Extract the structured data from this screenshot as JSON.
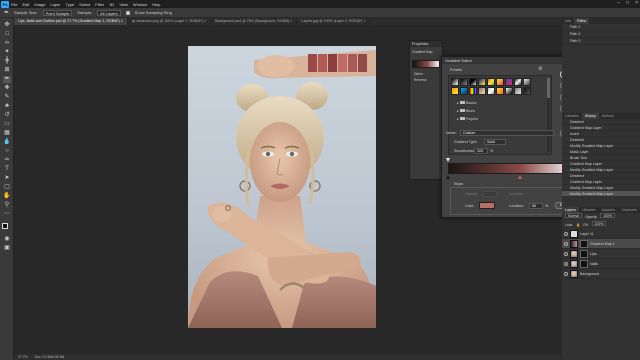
{
  "app": {
    "menu": [
      "File",
      "Edit",
      "Image",
      "Layer",
      "Type",
      "Select",
      "Filter",
      "3D",
      "View",
      "Window",
      "Help"
    ]
  },
  "options_bar": {
    "sample_size_label": "Sample Size:",
    "sample_size_value": "Point Sample",
    "sample_label": "Sample:",
    "sample_value": "All Layers",
    "show_ring": "Show Sampling Ring"
  },
  "tabs": [
    {
      "label": "Lips, Nails and Clothes.psd @ 27.7% (Gradient Map 1, RGB/8*) ×",
      "active": true
    },
    {
      "label": "lip-swatches.png @ 100% (Layer 1, RGB/8*) ×",
      "active": false
    },
    {
      "label": "Background.psd @ 25% (Background, RGB/8) ×",
      "active": false
    },
    {
      "label": "Layers.jpg @ 100% (Layer 0, RGB/8*) ×",
      "active": false
    }
  ],
  "status": {
    "zoom": "27.7%",
    "doc": "Doc: 21.9M/139.3M"
  },
  "properties": {
    "title": "Properties",
    "item": "Gradient Map",
    "dither": "Dither",
    "reverse": "Reverse"
  },
  "gradient_editor": {
    "title": "Gradient Editor",
    "presets_label": "Presets",
    "folders": [
      "Basics",
      "Blues",
      "Purples"
    ],
    "name_label": "Name:",
    "name_value": "Custom",
    "new_button": "New",
    "type_label": "Gradient Type:",
    "type_value": "Solid",
    "smooth_label": "Smoothness:",
    "smooth_value": "100",
    "pct": "%",
    "stops_label": "Stops",
    "opacity_label": "Opacity:",
    "location_label": "Location:",
    "color_label": "Color:",
    "location_value": "56",
    "delete_button": "Delete",
    "ok_button": "OK",
    "cancel_button": "Cancel",
    "import_button": "Import...",
    "export_button": "Export...",
    "stop_color": "#b86d68",
    "gradient_start": "#1b1513",
    "gradient_mid": "#8a4a47",
    "gradient_end": "#ffffff"
  },
  "panels": {
    "info_tabs": [
      "Info",
      "Paths"
    ],
    "paths": [
      "Path 1",
      "Path 2",
      "Path 3"
    ],
    "history_tabs": [
      "Libraries",
      "History",
      "Actions"
    ],
    "history_items": [
      "Deselect",
      "Gradient Map Layer",
      "Invert",
      "Deselect",
      "Modify Gradient Map Layer",
      "Mask Layer",
      "Brush Tool",
      "Gradient Map Layer",
      "Modify Gradient Map Layer",
      "Deselect",
      "Gradient Map Layer",
      "Modify Gradient Map Layer",
      "Modify Gradient Map Layer"
    ],
    "layers_tabs": [
      "Layers",
      "Libraries",
      "Adjustm.",
      "Channels"
    ],
    "blend_mode": "Normal",
    "opacity_label": "Opacity:",
    "opacity_value": "100%",
    "lock_label": "Lock:",
    "fill_label": "Fill:",
    "fill_value": "100%",
    "layers": [
      "Layer 11",
      "Gradient Map 1",
      "Lips",
      "Nails",
      "Background"
    ]
  },
  "accent": "#31a8ff"
}
